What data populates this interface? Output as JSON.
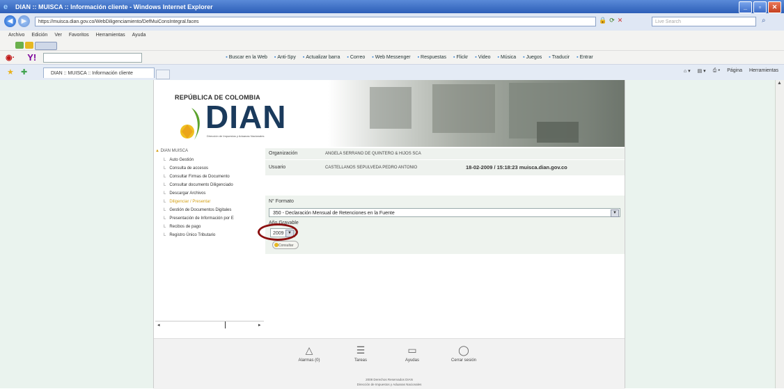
{
  "window": {
    "title": "DIAN :: MUISCA :: Información cliente - Windows Internet Explorer",
    "buttons": [
      "_",
      "▫",
      "✕"
    ]
  },
  "browser": {
    "address": "https://muisca.dian.gov.co/WebDiligenciamiento/DefMuiConsIntegral.faces",
    "search_placeholder": "Live Search",
    "menu": [
      "Archivo",
      "Edición",
      "Ver",
      "Favoritos",
      "Herramientas",
      "Ayuda"
    ],
    "yahoo_logo": "Y!",
    "yahoo_items": [
      "Buscar en la Web",
      "Anti-Spy",
      "Actualizar barra",
      "Correo",
      "Web Messenger",
      "Respuestas",
      "Flickr",
      "Video",
      "Música",
      "Juegos",
      "Traducir",
      "Entrar"
    ],
    "tab_label": "DIAN :: MUISCA :: Información cliente",
    "tab_tools": [
      "Página",
      "Herramientas"
    ]
  },
  "header": {
    "republica": "REPÚBLICA DE COLOMBIA",
    "logo": "DIAN",
    "logo_sub": "Dirección de Impuestos y Aduanas Nacionales"
  },
  "sidebar": {
    "root": "DIAN MUISCA",
    "items": [
      {
        "label": "Auto Gestión"
      },
      {
        "label": "Consulta de accesos"
      },
      {
        "label": "Consultar Firmas de Documento"
      },
      {
        "label": "Consultar documento Diligenciado"
      },
      {
        "label": "Descargar Archivos"
      },
      {
        "label": "Diligenciar / Presentar"
      },
      {
        "label": "Gestión de Documentos Digitales"
      },
      {
        "label": "Presentación de Información por E"
      },
      {
        "label": "Recibos de pago"
      },
      {
        "label": "Registro Único Tributario"
      }
    ],
    "active_index": 5
  },
  "info": {
    "org_label": "Organización",
    "org_value": "ANGELA SERRANO DE QUINTERO & HIJOS SCA",
    "user_label": "Usuario",
    "user_value": "CASTELLANOS SEPULVEDA PEDRO ANTONIO",
    "datetime": "18-02-2009 / 15:18:23 muisca.dian.gov.co"
  },
  "form": {
    "formato_label": "N° Formato",
    "formato_value": "350 - Declaración Mensual de Retenciones en la Fuente",
    "anio_label": "Año Gravable",
    "anio_value": "2009",
    "consultar": "Consultar"
  },
  "footer": {
    "buttons": [
      {
        "icon": "△",
        "label": "Alarmas (0)"
      },
      {
        "icon": "☰",
        "label": "Tareas"
      },
      {
        "icon": "▭",
        "label": "Ayudas"
      },
      {
        "icon": "◯",
        "label": "Cerrar sesión"
      }
    ],
    "copyright": "2008 Derechos Reservados DIAN",
    "entity": "Dirección de Impuestos y Aduanas Nacionales"
  },
  "colors": {
    "highlight": "#8b1010",
    "active_item": "#d4a017",
    "logo": "#1a3a5c"
  }
}
